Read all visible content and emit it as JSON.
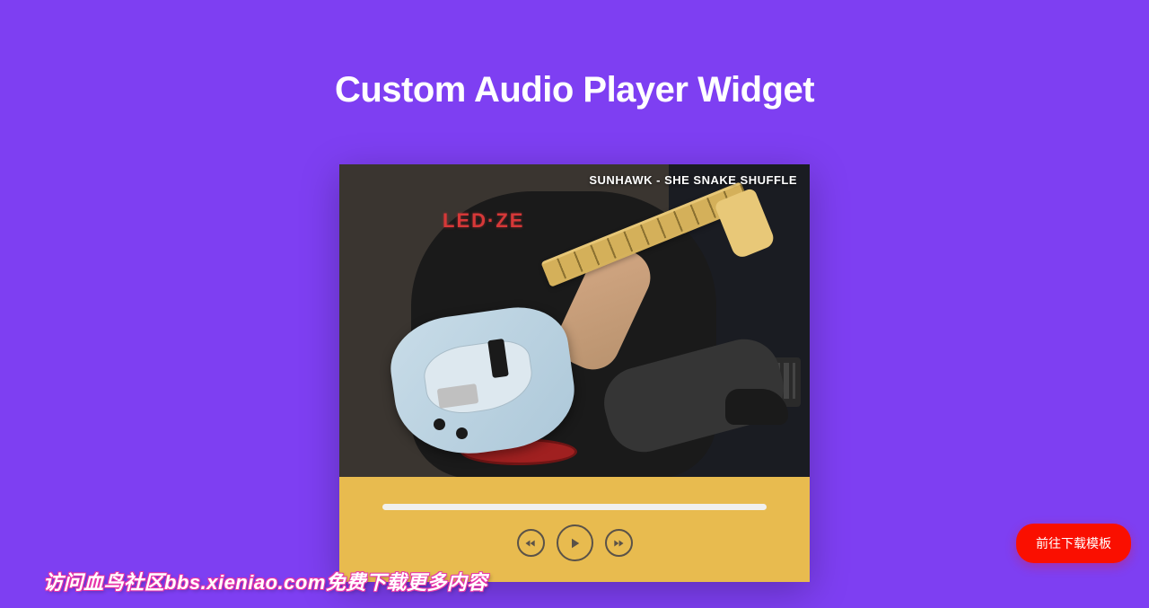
{
  "page": {
    "title": "Custom Audio Player Widget"
  },
  "player": {
    "track_label": "SUNHAWK - SHE SNAKE SHUFFLE",
    "shirt_text": "LED·ZE"
  },
  "buttons": {
    "download": "前往下载模板"
  },
  "watermark": {
    "text": "访问血鸟社区bbs.xieniao.com免费下载更多内容"
  },
  "colors": {
    "background": "#7e3ff2",
    "panel": "#e8bb4f",
    "progress": "#f1f0ed",
    "download": "#fa0f00"
  }
}
